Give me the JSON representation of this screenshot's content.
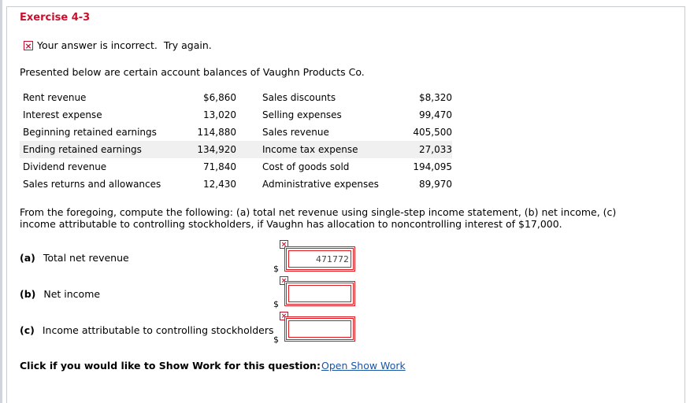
{
  "title": "Exercise 4-3",
  "feedback": {
    "text": "Your answer is incorrect.  Try again."
  },
  "intro": "Presented below are certain account balances of Vaughn Products Co.",
  "accounts": [
    {
      "left_label": "Rent revenue",
      "left_value": "$6,860",
      "right_label": "Sales discounts",
      "right_value": "$8,320"
    },
    {
      "left_label": "Interest expense",
      "left_value": "13,020",
      "right_label": "Selling expenses",
      "right_value": "99,470"
    },
    {
      "left_label": "Beginning retained earnings",
      "left_value": "114,880",
      "right_label": "Sales revenue",
      "right_value": "405,500"
    },
    {
      "left_label": "Ending retained earnings",
      "left_value": "134,920",
      "right_label": "Income tax expense",
      "right_value": "27,033"
    },
    {
      "left_label": "Dividend revenue",
      "left_value": "71,840",
      "right_label": "Cost of goods sold",
      "right_value": "194,095"
    },
    {
      "left_label": "Sales returns and allowances",
      "left_value": "12,430",
      "right_label": "Administrative expenses",
      "right_value": "89,970"
    }
  ],
  "question": "From the foregoing, compute the following: (a) total net revenue using single-step income statement, (b) net income, (c) income attributable to controlling stockholders, if Vaughn has allocation to noncontrolling interest of $17,000.",
  "answers": [
    {
      "letter": "(a)",
      "label": "Total net revenue",
      "currency": "$",
      "value": "471772"
    },
    {
      "letter": "(b)",
      "label": "Net income",
      "currency": "$",
      "value": ""
    },
    {
      "letter": "(c)",
      "label": "Income attributable to controlling stockholders",
      "currency": "$",
      "value": ""
    }
  ],
  "show_work": {
    "prompt": "Click if you would like to Show Work for this question:",
    "link": "Open Show Work"
  },
  "icons": {
    "incorrect": "error-x-icon"
  },
  "colors": {
    "error": "#c8102e",
    "link": "#1a55a6"
  }
}
